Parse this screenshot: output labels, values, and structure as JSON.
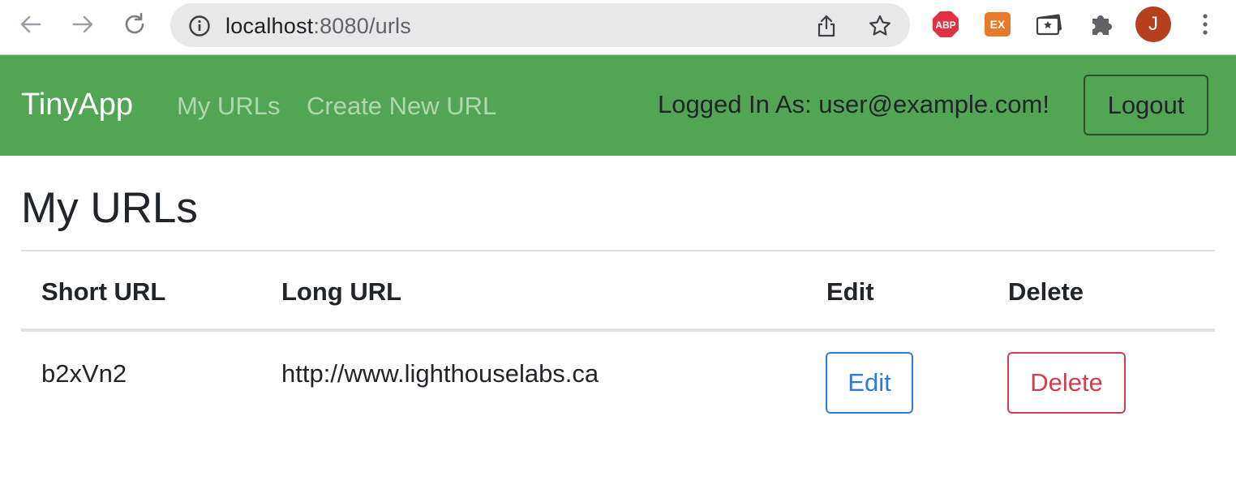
{
  "browser": {
    "url_host": "localhost",
    "url_path": ":8080/urls",
    "avatar_initial": "J",
    "extensions": {
      "abp_label": "ABP",
      "ex_label": "EX"
    },
    "icons": [
      "back-arrow-icon",
      "forward-arrow-icon",
      "reload-icon",
      "info-icon",
      "share-icon",
      "star-icon",
      "adblock-icon",
      "ex-extension-icon",
      "ticket-icon",
      "puzzle-icon",
      "menu-dots-icon"
    ]
  },
  "navbar": {
    "brand": "TinyApp",
    "links": [
      "My URLs",
      "Create New URL"
    ],
    "logged_in_text": "Logged In As: user@example.com!",
    "logout_label": "Logout",
    "bg_color": "#52a552"
  },
  "main": {
    "title": "My URLs",
    "table": {
      "headers": [
        "Short URL",
        "Long URL",
        "Edit",
        "Delete"
      ],
      "rows": [
        {
          "short_url": "b2xVn2",
          "long_url": "http://www.lighthouselabs.ca",
          "edit_label": "Edit",
          "delete_label": "Delete"
        }
      ]
    }
  }
}
